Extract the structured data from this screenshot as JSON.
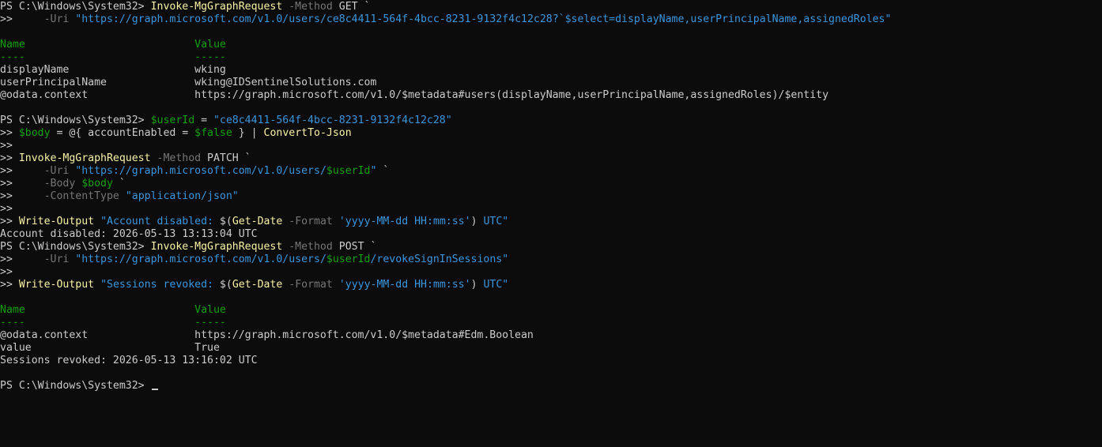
{
  "terminal": {
    "prompt": "PS C:\\Windows\\System32> ",
    "lines": [
      [
        [
          "PS C:\\Windows\\System32> ",
          "default"
        ],
        [
          "Invoke-MgGraphRequest",
          "cmd"
        ],
        [
          " -Method",
          "param"
        ],
        [
          " GET `",
          "default"
        ]
      ],
      [
        [
          ">>     ",
          "cont"
        ],
        [
          "-Uri",
          "param"
        ],
        [
          " ",
          "default"
        ],
        [
          "\"https://graph.microsoft.com/v1.0/users/ce8c4411-564f-4bcc-8231-9132f4c12c28?`$select=displayName,userPrincipalName,assignedRoles\"",
          "str"
        ]
      ],
      [],
      [
        [
          "Name                           Value",
          "header"
        ]
      ],
      [
        [
          "----                           -----",
          "header"
        ]
      ],
      [
        [
          "displayName                    wking",
          "default"
        ]
      ],
      [
        [
          "userPrincipalName              wking@IDSentinelSolutions.com",
          "default"
        ]
      ],
      [
        [
          "@odata.context                 https://graph.microsoft.com/v1.0/$metadata#users(displayName,userPrincipalName,assignedRoles)/$entity",
          "default"
        ]
      ],
      [],
      [
        [
          "PS C:\\Windows\\System32> ",
          "default"
        ],
        [
          "$userId",
          "var"
        ],
        [
          " = ",
          "op"
        ],
        [
          "\"ce8c4411-564f-4bcc-8231-9132f4c12c28\"",
          "str"
        ]
      ],
      [
        [
          ">> ",
          "cont"
        ],
        [
          "$body",
          "var"
        ],
        [
          " = @{ accountEnabled = ",
          "op"
        ],
        [
          "$false",
          "var"
        ],
        [
          " } | ",
          "op"
        ],
        [
          "ConvertTo-Json",
          "cmd"
        ]
      ],
      [
        [
          ">>",
          "cont"
        ]
      ],
      [
        [
          ">> ",
          "cont"
        ],
        [
          "Invoke-MgGraphRequest",
          "cmd"
        ],
        [
          " -Method",
          "param"
        ],
        [
          " PATCH `",
          "default"
        ]
      ],
      [
        [
          ">>     ",
          "cont"
        ],
        [
          "-Uri",
          "param"
        ],
        [
          " ",
          "default"
        ],
        [
          "\"https://graph.microsoft.com/v1.0/users/",
          "str"
        ],
        [
          "$userId",
          "var"
        ],
        [
          "\"",
          "str"
        ],
        [
          " `",
          "default"
        ]
      ],
      [
        [
          ">>     ",
          "cont"
        ],
        [
          "-Body",
          "param"
        ],
        [
          " ",
          "default"
        ],
        [
          "$body",
          "var"
        ],
        [
          " `",
          "default"
        ]
      ],
      [
        [
          ">>     ",
          "cont"
        ],
        [
          "-ContentType",
          "param"
        ],
        [
          " ",
          "default"
        ],
        [
          "\"application/json\"",
          "str"
        ]
      ],
      [
        [
          ">>",
          "cont"
        ]
      ],
      [
        [
          ">> ",
          "cont"
        ],
        [
          "Write-Output",
          "cmd"
        ],
        [
          " ",
          "default"
        ],
        [
          "\"Account disabled: ",
          "str"
        ],
        [
          "$(",
          "op"
        ],
        [
          "Get-Date",
          "cmd"
        ],
        [
          " -Format",
          "param"
        ],
        [
          " ",
          "default"
        ],
        [
          "'yyyy-MM-dd HH:mm:ss'",
          "str"
        ],
        [
          ")",
          "op"
        ],
        [
          " UTC\"",
          "str"
        ]
      ],
      [
        [
          "Account disabled: 2026-05-13 13:13:04 UTC",
          "default"
        ]
      ],
      [
        [
          "PS C:\\Windows\\System32> ",
          "default"
        ],
        [
          "Invoke-MgGraphRequest",
          "cmd"
        ],
        [
          " -Method",
          "param"
        ],
        [
          " POST `",
          "default"
        ]
      ],
      [
        [
          ">>     ",
          "cont"
        ],
        [
          "-Uri",
          "param"
        ],
        [
          " ",
          "default"
        ],
        [
          "\"https://graph.microsoft.com/v1.0/users/",
          "str"
        ],
        [
          "$userId",
          "var"
        ],
        [
          "/revokeSignInSessions\"",
          "str"
        ]
      ],
      [
        [
          ">>",
          "cont"
        ]
      ],
      [
        [
          ">> ",
          "cont"
        ],
        [
          "Write-Output",
          "cmd"
        ],
        [
          " ",
          "default"
        ],
        [
          "\"Sessions revoked: ",
          "str"
        ],
        [
          "$(",
          "op"
        ],
        [
          "Get-Date",
          "cmd"
        ],
        [
          " -Format",
          "param"
        ],
        [
          " ",
          "default"
        ],
        [
          "'yyyy-MM-dd HH:mm:ss'",
          "str"
        ],
        [
          ")",
          "op"
        ],
        [
          " UTC\"",
          "str"
        ]
      ],
      [],
      [
        [
          "Name                           Value",
          "header"
        ]
      ],
      [
        [
          "----                           -----",
          "header"
        ]
      ],
      [
        [
          "@odata.context                 https://graph.microsoft.com/v1.0/$metadata#Edm.Boolean",
          "default"
        ]
      ],
      [
        [
          "value                          True",
          "default"
        ]
      ],
      [
        [
          "Sessions revoked: 2026-05-13 13:16:02 UTC",
          "default"
        ]
      ],
      [],
      [
        [
          "PS C:\\Windows\\System32> ",
          "default"
        ]
      ]
    ]
  },
  "colors": {
    "background": "#0c0c0c",
    "default": "#cccccc",
    "command": "#f9f1a5",
    "parameter": "#767676",
    "string": "#3a96dd",
    "variable": "#13a10e",
    "header": "#13a10e"
  }
}
